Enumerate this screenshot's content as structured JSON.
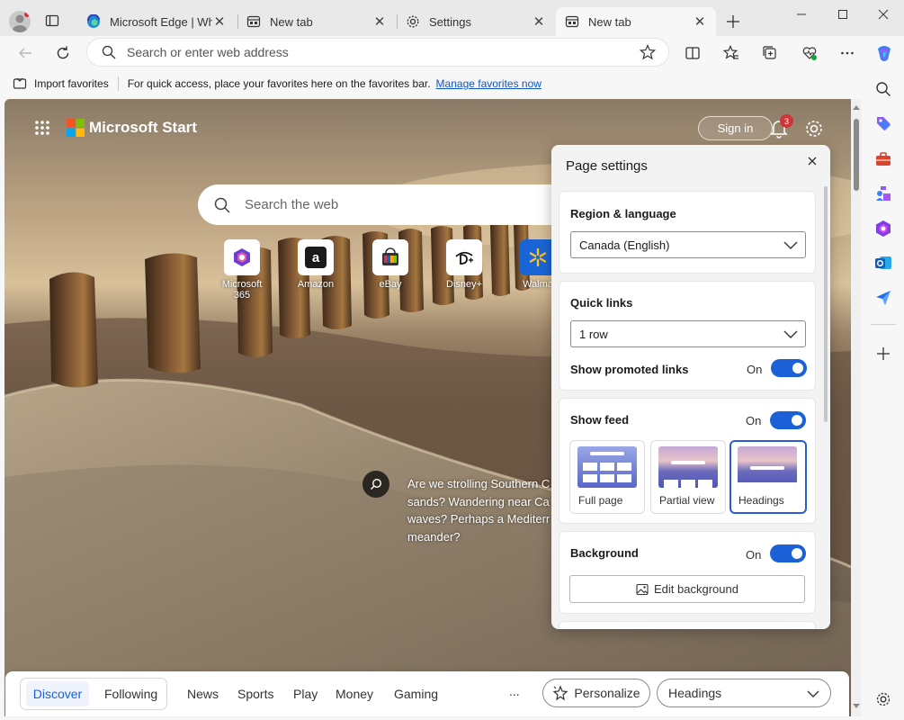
{
  "tabs": [
    {
      "label": "Microsoft Edge | What",
      "icon": "edge-icon"
    },
    {
      "label": "New tab",
      "icon": "newtab-icon"
    },
    {
      "label": "Settings",
      "icon": "gear-icon"
    },
    {
      "label": "New tab",
      "icon": "newtab-icon",
      "active": true
    }
  ],
  "address": {
    "placeholder": "Search or enter web address"
  },
  "favorites": {
    "import_label": "Import favorites",
    "message": "For quick access, place your favorites here on the favorites bar.",
    "manage_link": "Manage favorites now"
  },
  "start": {
    "brand": "Microsoft Start",
    "sign_in": "Sign in",
    "notification_count": "3",
    "search_placeholder": "Search the web",
    "caption": [
      "Are we strolling Southern C",
      "sands? Wandering near Ca",
      "waves? Perhaps a Mediterr",
      "meander?"
    ]
  },
  "quick_links": [
    {
      "label": "Microsoft 365",
      "icon": "microsoft365-icon"
    },
    {
      "label": "Amazon",
      "icon": "amazon-icon"
    },
    {
      "label": "eBay",
      "icon": "ebay-icon"
    },
    {
      "label": "Disney+",
      "icon": "disney-icon"
    },
    {
      "label": "Walma",
      "icon": "walmart-icon"
    }
  ],
  "panel": {
    "title": "Page settings",
    "region": {
      "title": "Region & language",
      "value": "Canada (English)"
    },
    "quick_links": {
      "title": "Quick links",
      "value": "1 row",
      "promoted_label": "Show promoted links",
      "promoted_state": "On"
    },
    "feed": {
      "title": "Show feed",
      "state": "On",
      "options": [
        "Full page",
        "Partial view",
        "Headings"
      ],
      "selected": "Headings"
    },
    "background": {
      "title": "Background",
      "state": "On",
      "edit_label": "Edit background"
    }
  },
  "nav": {
    "items": [
      "Discover",
      "Following",
      "News",
      "Sports",
      "Play",
      "Money",
      "Gaming"
    ],
    "more": "...",
    "personalize": "Personalize",
    "layout_select": "Headings"
  },
  "colors": {
    "accent": "#1b60d6",
    "link": "#0f55c4"
  }
}
